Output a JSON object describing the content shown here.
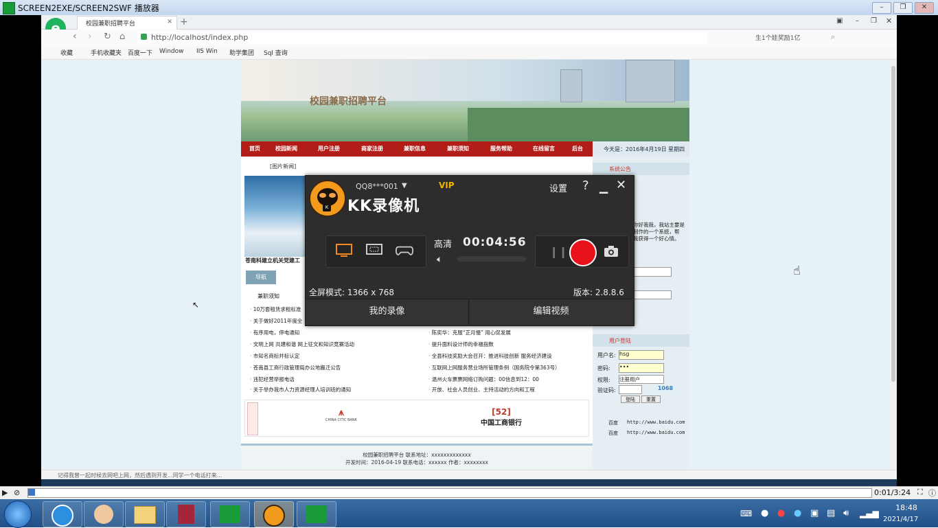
{
  "player": {
    "title": "SCREEN2EXE/SCREEN2SWF 播放器",
    "time": "0:01/3:24",
    "progress": 0.005
  },
  "browser": {
    "tab_title": "校园兼职招聘平台",
    "url": "http://localhost/index.php",
    "search_hint": "生1个娃奖励1亿",
    "bookmarks": [
      "收藏",
      "手机收藏夹",
      "百度一下",
      "Window",
      "IIS Win",
      "助学集团",
      "Sql 查询"
    ],
    "status_text": "记得我曾一起时候去网吧上网，然后遇到开发...同学一个电话打来..."
  },
  "site": {
    "banner_title": "校园兼职招聘平台",
    "menu": [
      "首页",
      "校园新闻",
      "用户注册",
      "商家注册",
      "兼职信息",
      "兼职须知",
      "服务帮助",
      "在线留言",
      "后台"
    ],
    "date": "今天是：2016年4月19日 星期四",
    "announcement_title": "系统公告",
    "announcement_text": [
      "你好我我，我站主要是",
      "制作的一个系统，帮",
      "我获得一个好心情。"
    ],
    "pic_news_label": "[图片新闻]",
    "pic_caption": "苍南科建立机关党建工",
    "guide_tab": "导航",
    "notice_title": "兼职须知",
    "news_left": [
      "10万套租赁求租标准",
      "关于做好2011年度全",
      "有序用电，停电通知",
      "文明上网 共建和谐 网上征文和知识竞赛活动",
      "市知名商标并标认定",
      "苍南县工商行政管理局办公地搬迁公告",
      "违犯经营举报电话",
      "关于举办我市人力资源经理人培训班的通知"
    ],
    "news_right": [
      "陈奕华：克服“正月慢” 用心促发展",
      "提升面料设计师的幸福指数",
      "全县科技奖励大会召开：推进科技创新 服务经济建设",
      "互联网上网服务营业场所管理条例（国务院令第363号）",
      "温州火车票票网络订购问题：00信息到12：00",
      "开放、社会人员创业、主持活动的方向和工程"
    ],
    "login_title": "用户登陆",
    "login_labels": {
      "username": "用户名:",
      "password": "密码:",
      "role": "权限:",
      "captcha": "验证码:"
    },
    "login_values": {
      "username": "hsg",
      "password": "•••",
      "role": "注册用户",
      "captcha": "1068"
    },
    "login_buttons": [
      "登陆",
      "重置"
    ],
    "links": [
      {
        "name": "百度",
        "url": "http://www.baidu.com"
      },
      {
        "name": "百度",
        "url": "http://www.baidu.com"
      }
    ],
    "logos": [
      "CHINA CITIC BANK",
      "中国工商银行"
    ],
    "footer": [
      "校园兼职招聘平台 联系地址：xxxxxxxxxxxxx",
      "开发时间：2016-04-19 联系电话：xxxxxx 作者：xxxxxxxx"
    ]
  },
  "recorder": {
    "name": "KK录像机",
    "account": "QQ8***001",
    "vip": "VIP",
    "settings": "设置",
    "help": "?",
    "quality": "高清",
    "timer": "00:04:56",
    "mode": "全屏模式: 1366 x 768",
    "version": "版本: 2.8.8.6",
    "my_recordings": "我的录像",
    "edit_video": "编辑视频"
  },
  "taskbar": {
    "time": "18:48",
    "date": "2021/4/17"
  }
}
